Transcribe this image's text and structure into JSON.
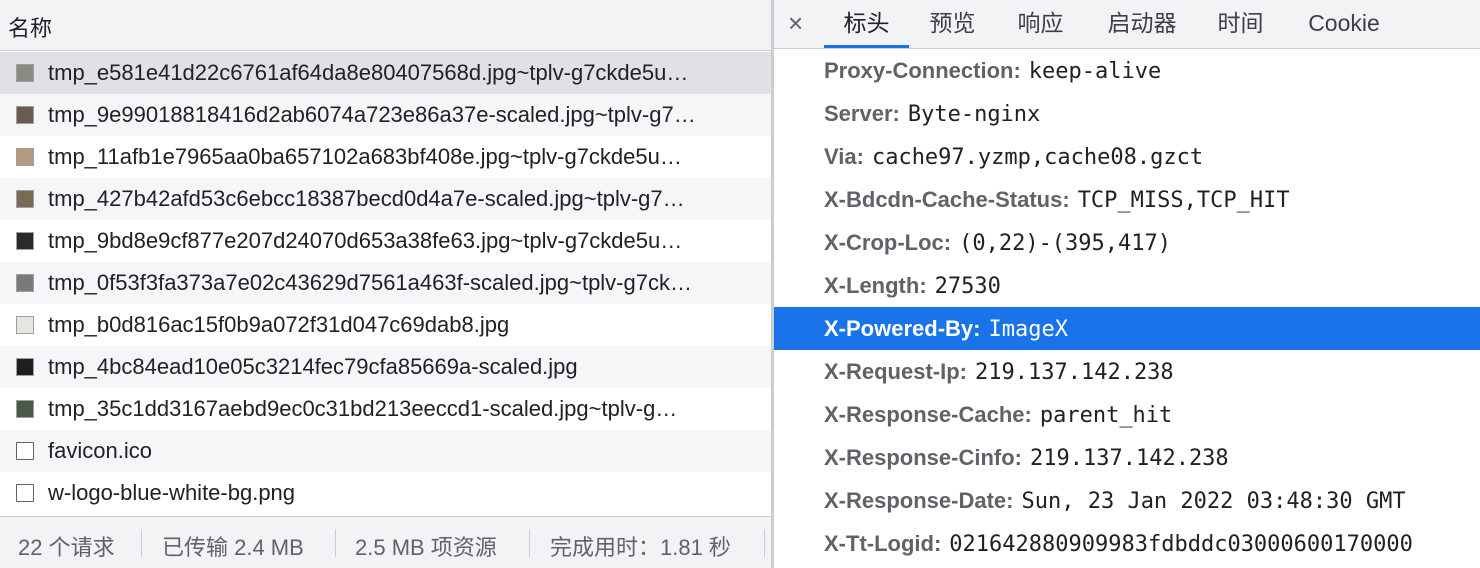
{
  "left_pane": {
    "header": "名称",
    "requests": [
      {
        "name": "tmp_e581e41d22c6761af64da8e80407568d.jpg~tplv-g7ckde5u…",
        "thumb_color": "#8a8a80"
      },
      {
        "name": "tmp_9e99018818416d2ab6074a723e86a37e-scaled.jpg~tplv-g7…",
        "thumb_color": "#6b5a50"
      },
      {
        "name": "tmp_11afb1e7965aa0ba657102a683bf408e.jpg~tplv-g7ckde5u…",
        "thumb_color": "#b59a80"
      },
      {
        "name": "tmp_427b42afd53c6ebcc18387becd0d4a7e-scaled.jpg~tplv-g7…",
        "thumb_color": "#7a6a50"
      },
      {
        "name": "tmp_9bd8e9cf877e207d24070d653a38fe63.jpg~tplv-g7ckde5u…",
        "thumb_color": "#2a2a2a"
      },
      {
        "name": "tmp_0f53f3fa373a7e02c43629d7561a463f-scaled.jpg~tplv-g7ck…",
        "thumb_color": "#7a7a7a"
      },
      {
        "name": "tmp_b0d816ac15f0b9a072f31d047c69dab8.jpg",
        "thumb_color": "#e8e6e0"
      },
      {
        "name": "tmp_4bc84ead10e05c3214fec79cfa85669a-scaled.jpg",
        "thumb_color": "#1e1e1e"
      },
      {
        "name": "tmp_35c1dd3167aebd9ec0c31bd213eeccd1-scaled.jpg~tplv-g…",
        "thumb_color": "#4a5a4a"
      },
      {
        "name": "favicon.ico",
        "thumb_color": ""
      },
      {
        "name": "w-logo-blue-white-bg.png",
        "thumb_color": ""
      }
    ],
    "footer": {
      "requests": "22 个请求",
      "transferred": "已传输 2.4 MB",
      "resources": "2.5 MB 项资源",
      "finish": "完成用时：1.81 秒"
    }
  },
  "right_pane": {
    "close_label": "×",
    "tabs": [
      "标头",
      "预览",
      "响应",
      "启动器",
      "时间",
      "Cookie"
    ],
    "headers": [
      {
        "key": "Proxy-Connection:",
        "value": "keep-alive"
      },
      {
        "key": "Server:",
        "value": "Byte-nginx"
      },
      {
        "key": "Via:",
        "value": "cache97.yzmp,cache08.gzct"
      },
      {
        "key": "X-Bdcdn-Cache-Status:",
        "value": "TCP_MISS,TCP_HIT"
      },
      {
        "key": "X-Crop-Loc:",
        "value": "(0,22)-(395,417)"
      },
      {
        "key": "X-Length:",
        "value": "27530"
      },
      {
        "key": "X-Powered-By:",
        "value": "ImageX"
      },
      {
        "key": "X-Request-Ip:",
        "value": "219.137.142.238"
      },
      {
        "key": "X-Response-Cache:",
        "value": "parent_hit"
      },
      {
        "key": "X-Response-Cinfo:",
        "value": "219.137.142.238"
      },
      {
        "key": "X-Response-Date:",
        "value": "Sun, 23 Jan 2022 03:48:30 GMT"
      },
      {
        "key": "X-Tt-Logid:",
        "value": "021642880909983fdbddc03000600170000"
      }
    ]
  },
  "colors": {
    "accent": "#1a73e8",
    "selected_row": "#dfe1e5",
    "header_bg": "#f1f3f4"
  }
}
